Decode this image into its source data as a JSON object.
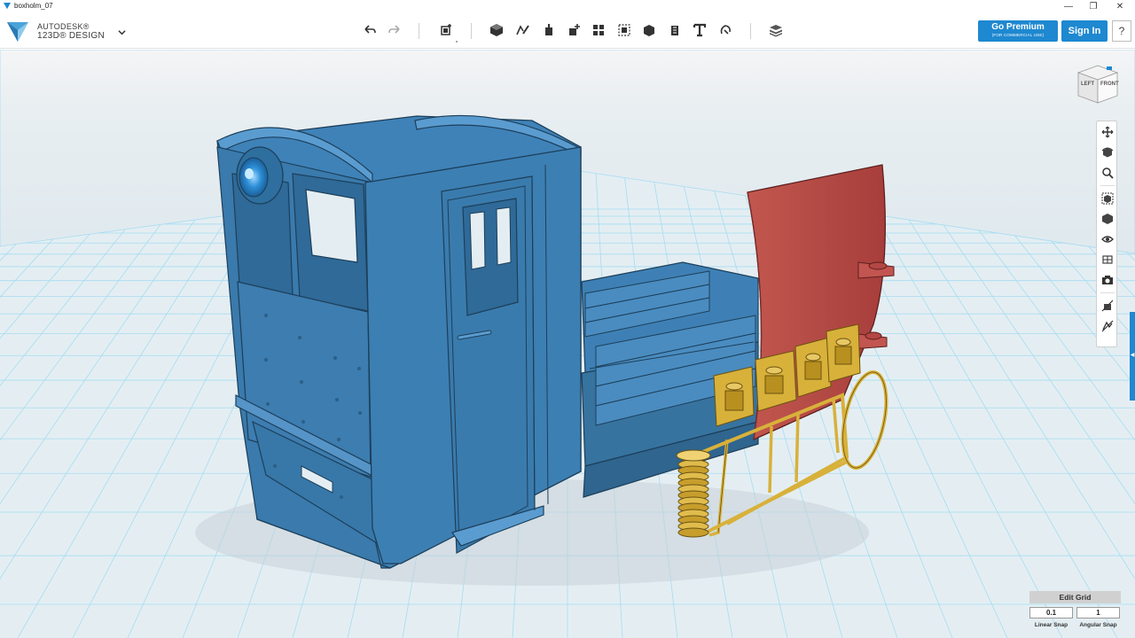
{
  "window": {
    "title": "boxholm_07",
    "minimize_glyph": "—",
    "maximize_glyph": "❐",
    "close_glyph": "✕"
  },
  "brand": {
    "line1": "AUTODESK®",
    "line2": "123D® DESIGN",
    "icon": "autodesk-123d-logo"
  },
  "toolbar": {
    "icons": [
      "undo-icon",
      "redo-icon",
      "transform-icon",
      "primitives-icon",
      "sketch-icon",
      "construct-icon",
      "modify-icon",
      "pattern-icon",
      "group-icon",
      "combine-icon",
      "measure-icon",
      "text-icon",
      "snap-icon",
      "material-icon"
    ]
  },
  "account": {
    "premium_label": "Go Premium",
    "premium_sub": "(FOR COMMERCIAL USE)",
    "signin_label": "Sign In",
    "help_label": "?"
  },
  "viewcube": {
    "left_label": "LEFT",
    "front_label": "FRONT"
  },
  "navbar": {
    "icons": [
      "pan-icon",
      "orbit-icon",
      "zoom-icon",
      "fit-icon",
      "view-mode-icon",
      "visibility-icon",
      "materials-outline-icon",
      "camera-icon",
      "hide-grid-icon",
      "hide-sketch-icon"
    ]
  },
  "grid": {
    "edit_label": "Edit Grid",
    "linear_snap_value": "0.1",
    "linear_snap_label": "Linear Snap",
    "angular_snap_value": "1",
    "angular_snap_label": "Angular Snap"
  },
  "colors": {
    "accent": "#1e88d0",
    "model_blue": "#3d7fb4",
    "model_red": "#b94a48",
    "model_gold": "#d8b13a",
    "grid_bg": "#e6edf0",
    "grid_line": "#9fd6ee"
  }
}
